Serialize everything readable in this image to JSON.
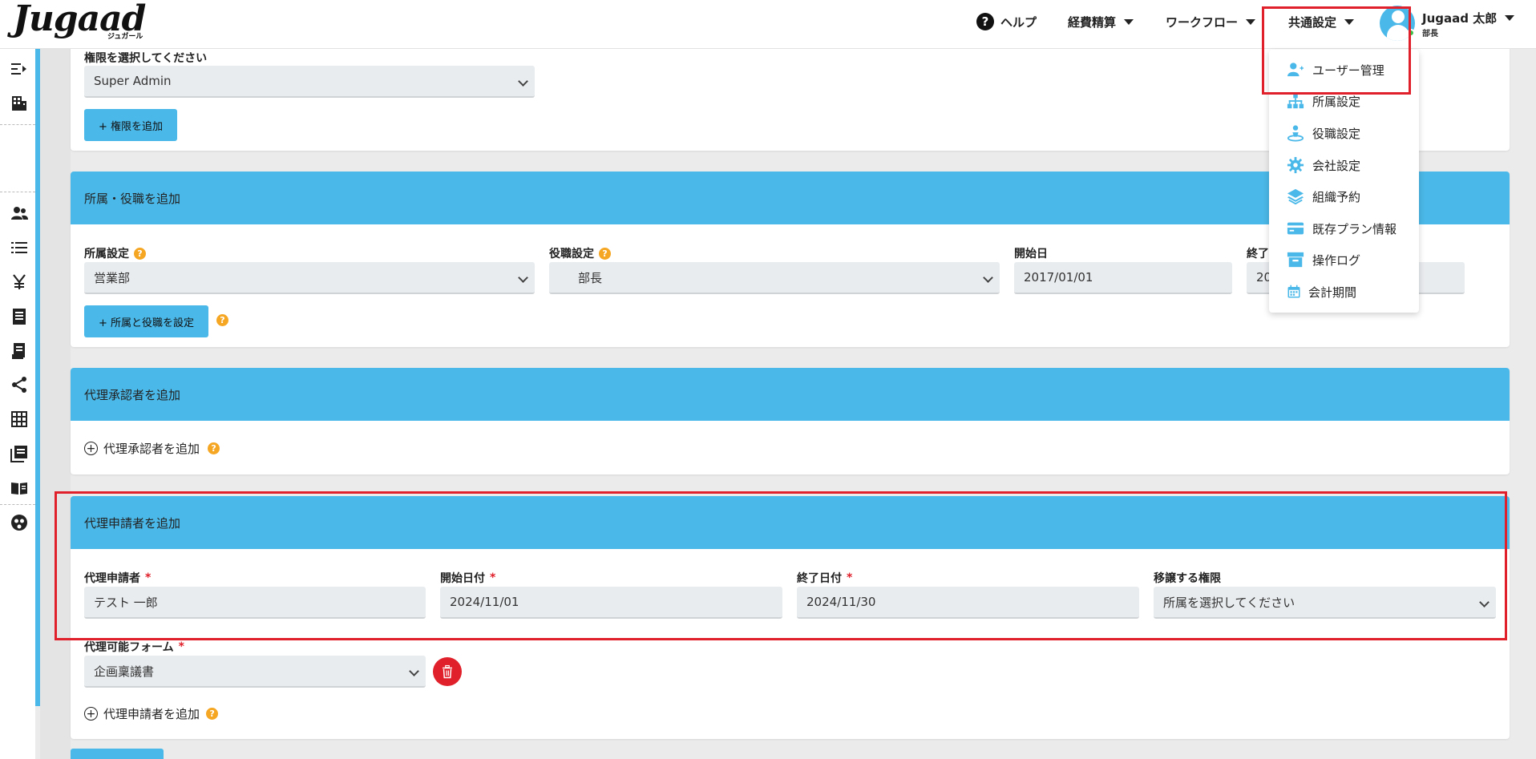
{
  "header": {
    "logo": "Jugaad",
    "logo_sub": "ジュガール",
    "nav": {
      "help": "ヘルプ",
      "expense": "経費精算",
      "workflow": "ワークフロー",
      "common": "共通設定"
    },
    "user": {
      "name": "Jugaad 太郎",
      "role": "部長"
    }
  },
  "dropdown": {
    "items": [
      {
        "label": "ユーザー管理",
        "icon": "user-add-icon"
      },
      {
        "label": "所属設定",
        "icon": "org-tree-icon"
      },
      {
        "label": "役職設定",
        "icon": "position-icon"
      },
      {
        "label": "会社設定",
        "icon": "gear-icon"
      },
      {
        "label": "組織予約",
        "icon": "layers-icon"
      },
      {
        "label": "既存プラン情報",
        "icon": "credit-card-icon"
      },
      {
        "label": "操作ログ",
        "icon": "archive-icon"
      },
      {
        "label": "会計期間",
        "icon": "calendar-icon"
      }
    ]
  },
  "permission": {
    "label": "権限を選択してください",
    "value": "Super Admin",
    "add_button": "+ 権限を追加"
  },
  "affiliation": {
    "title": "所属・役職を追加",
    "dept_label": "所属設定",
    "dept_value": "営業部",
    "role_label": "役職設定",
    "role_value": "部長",
    "start_label": "開始日",
    "start_value": "2017/01/01",
    "end_label": "終了",
    "end_value": "20",
    "set_button": "+ 所属と役職を設定",
    "help": "?"
  },
  "approver": {
    "title": "代理承認者を追加",
    "add_link": "代理承認者を追加",
    "help": "?"
  },
  "applicant": {
    "title": "代理申請者を追加",
    "applicant_label": "代理申請者",
    "applicant_value": "テスト 一郎",
    "start_label": "開始日付",
    "start_value": "2024/11/01",
    "end_label": "終了日付",
    "end_value": "2024/11/30",
    "perm_label": "移譲する権限",
    "perm_value": "所属を選択してください",
    "form_label": "代理可能フォーム",
    "form_value": "企画稟議書",
    "add_link": "代理申請者を追加",
    "required_mark": "*",
    "help": "?"
  },
  "colors": {
    "accent": "#4ab8e8",
    "danger": "#e0202a",
    "help": "#f5a623"
  }
}
